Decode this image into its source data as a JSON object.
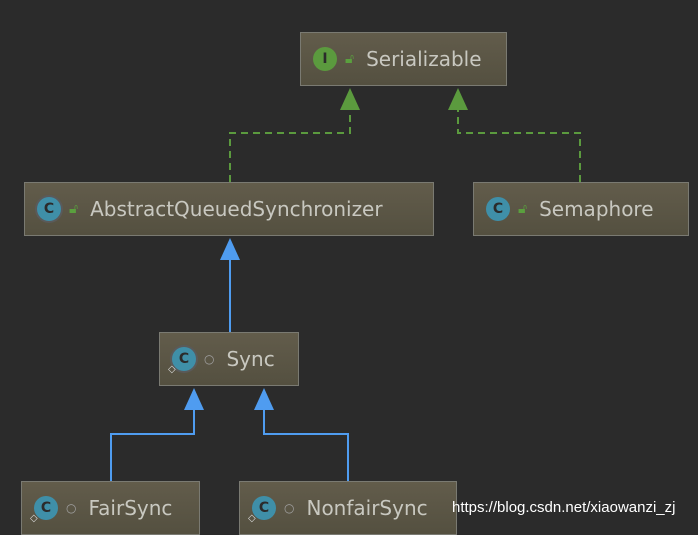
{
  "nodes": {
    "serializable": {
      "label": "Serializable",
      "kind": "interface",
      "icon": "I",
      "visibility": "public"
    },
    "aqs": {
      "label": "AbstractQueuedSynchronizer",
      "kind": "abstract-class",
      "icon": "C",
      "visibility": "public"
    },
    "semaphore": {
      "label": "Semaphore",
      "kind": "class",
      "icon": "C",
      "visibility": "public"
    },
    "sync": {
      "label": "Sync",
      "kind": "abstract-static-class",
      "icon": "C",
      "visibility": "package"
    },
    "fairsync": {
      "label": "FairSync",
      "kind": "static-class",
      "icon": "C",
      "visibility": "package"
    },
    "nonfairsync": {
      "label": "NonfairSync",
      "kind": "static-class",
      "icon": "C",
      "visibility": "package"
    }
  },
  "edges": [
    {
      "from": "AbstractQueuedSynchronizer",
      "to": "Serializable",
      "type": "implements",
      "color": "#5b9a3e"
    },
    {
      "from": "Semaphore",
      "to": "Serializable",
      "type": "implements",
      "color": "#5b9a3e"
    },
    {
      "from": "Sync",
      "to": "AbstractQueuedSynchronizer",
      "type": "extends",
      "color": "#4f9cf0"
    },
    {
      "from": "FairSync",
      "to": "Sync",
      "type": "extends",
      "color": "#4f9cf0"
    },
    {
      "from": "NonfairSync",
      "to": "Sync",
      "type": "extends",
      "color": "#4f9cf0"
    }
  ],
  "watermark": "https://blog.csdn.net/xiaowanzi_zj"
}
